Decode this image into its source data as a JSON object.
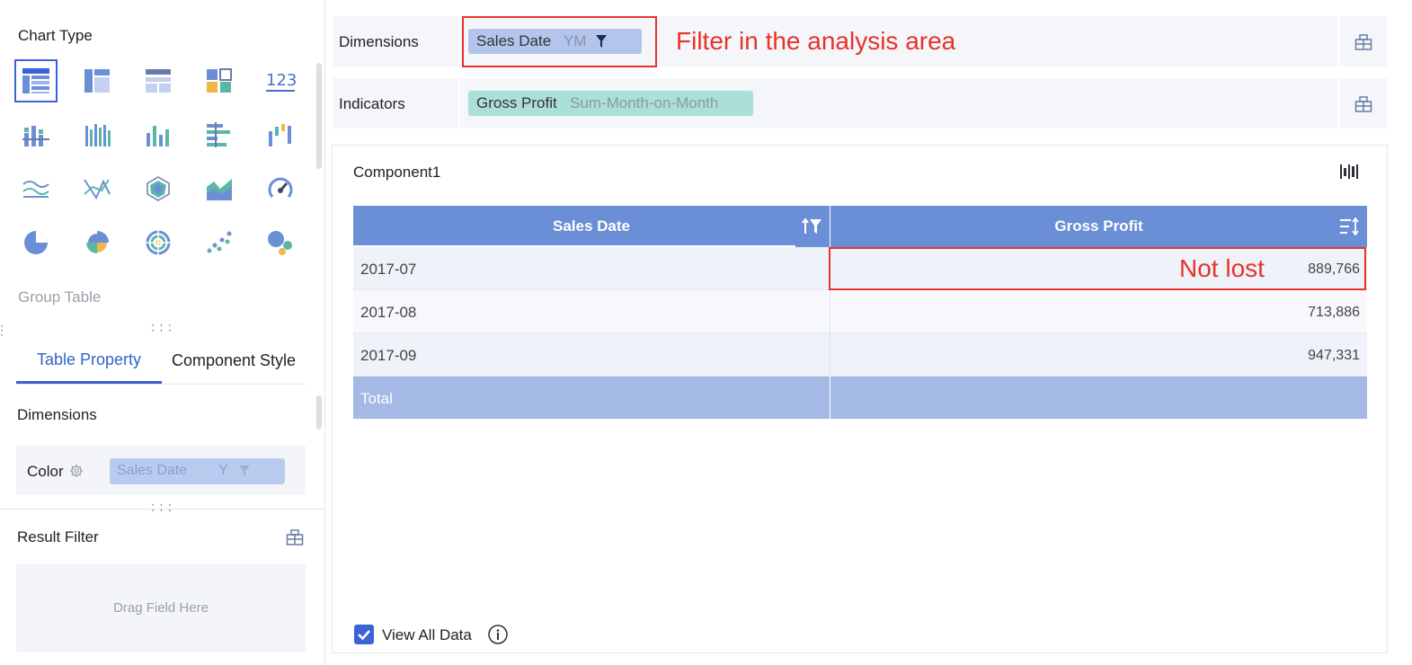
{
  "left_panel": {
    "chart_type_title": "Chart Type",
    "chart_icons": [
      {
        "name": "group-table-icon",
        "selected": true
      },
      {
        "name": "cross-table-icon"
      },
      {
        "name": "detail-table-icon"
      },
      {
        "name": "mixed-layout-icon"
      },
      {
        "name": "kpi-number-icon",
        "text": "123"
      },
      {
        "name": "stacked-column-icon"
      },
      {
        "name": "grouped-column-icon"
      },
      {
        "name": "column-chart-icon"
      },
      {
        "name": "bar-chart-icon"
      },
      {
        "name": "waterfall-icon"
      },
      {
        "name": "line-chart-icon"
      },
      {
        "name": "scatter-line-icon"
      },
      {
        "name": "radar-icon"
      },
      {
        "name": "area-chart-icon"
      },
      {
        "name": "gauge-icon"
      },
      {
        "name": "pie-chart-icon"
      },
      {
        "name": "rose-pie-icon"
      },
      {
        "name": "multi-ring-icon"
      },
      {
        "name": "scatter-plot-icon"
      },
      {
        "name": "bubble-icon"
      }
    ],
    "chart_type_caption": "Group Table",
    "tabs": [
      "Table Property",
      "Component Style"
    ],
    "dimensions_label": "Dimensions",
    "color_label": "Color",
    "color_chip": {
      "name": "Sales Date",
      "format": "Y"
    },
    "result_filter_label": "Result Filter",
    "drop_placeholder": "Drag Field Here"
  },
  "analysis": {
    "dimensions_label": "Dimensions",
    "dimension_chip": {
      "name": "Sales Date",
      "format": "YM"
    },
    "indicators_label": "Indicators",
    "indicator_chip": {
      "name": "Gross Profit",
      "calc": "Sum-Month-on-Month"
    }
  },
  "annotations": {
    "filter_note": "Filter in the analysis area",
    "not_lost_note": "Not lost"
  },
  "colors": {
    "accent": "#3a63d6",
    "table_header": "#6b8fd6",
    "total_row": "#a4b9e5",
    "annotation_red": "#e8332a",
    "dimension_chip": "#b3c5ec",
    "indicator_chip": "#acdfd9"
  },
  "component": {
    "title": "Component1",
    "table": {
      "columns": [
        "Sales Date",
        "Gross Profit"
      ],
      "rows": [
        {
          "date": "2017-07",
          "profit": "889,766"
        },
        {
          "date": "2017-08",
          "profit": "713,886"
        },
        {
          "date": "2017-09",
          "profit": "947,331"
        }
      ],
      "total_label": "Total",
      "total_value": ""
    },
    "view_all_data_label": "View All Data",
    "view_all_checked": true
  }
}
